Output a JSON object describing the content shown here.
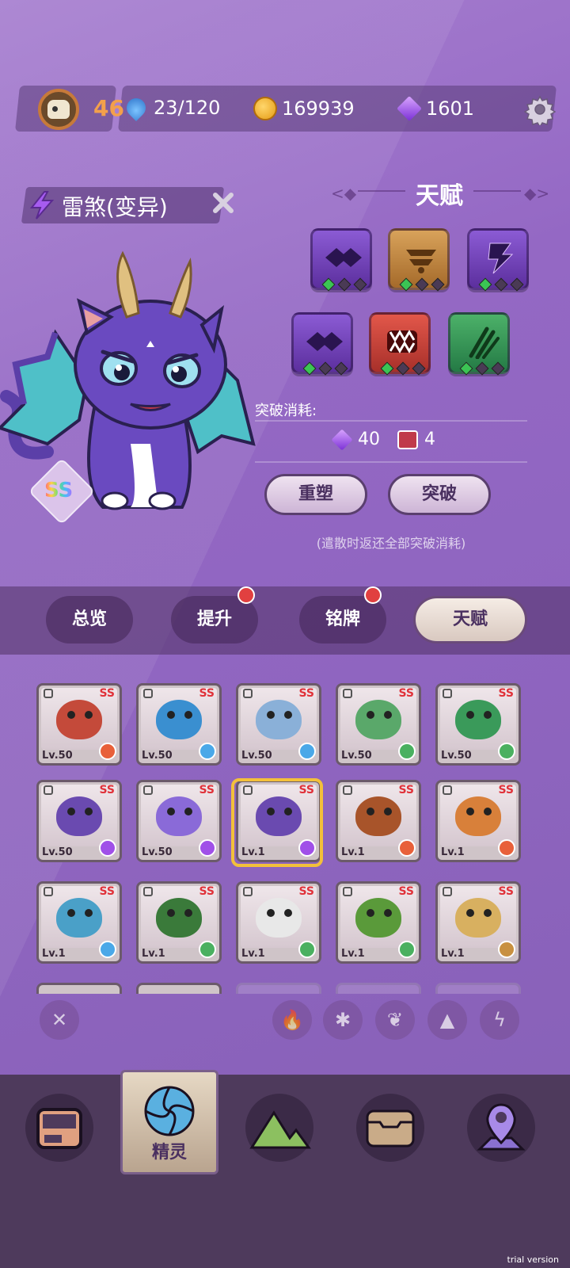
{
  "topbar": {
    "level": "46",
    "stamina": "23/120",
    "coins": "169939",
    "gems": "1601",
    "icons": [
      "skull-avatar",
      "water-drop-icon",
      "paw-coin-icon",
      "purple-gem-icon",
      "gear-icon"
    ]
  },
  "creature": {
    "name": "雷煞(变异)",
    "grade": "SS",
    "element": "lightning"
  },
  "talent": {
    "title": "天赋",
    "skills": [
      {
        "icon": "purple-diamond-skill",
        "color": "#7a48c4",
        "stars": 1
      },
      {
        "icon": "gold-crown-skill",
        "color": "#c08a40",
        "stars": 1
      },
      {
        "icon": "lightning-skill",
        "color": "#7a48c4",
        "stars": 1
      },
      {
        "icon": "purple-diamond-skill",
        "color": "#7a48c4",
        "stars": 1
      },
      {
        "icon": "fang-skill",
        "color": "#c8443a",
        "stars": 1
      },
      {
        "icon": "claw-skill",
        "color": "#3a9a58",
        "stars": 1
      }
    ],
    "cost_label": "突破消耗:",
    "cost_gem": "40",
    "cost_book": "4",
    "reshape_button": "重塑",
    "breakthrough_button": "突破",
    "hint": "(遣散时返还全部突破消耗)"
  },
  "tabs": [
    {
      "label": "总览",
      "badge": false
    },
    {
      "label": "提升",
      "badge": true
    },
    {
      "label": "铭牌",
      "badge": true
    },
    {
      "label": "天赋",
      "badge": false,
      "active": true
    }
  ],
  "cards": [
    {
      "lv": "Lv.50",
      "grade": "SS",
      "color": "#c44a3a",
      "element": "fire"
    },
    {
      "lv": "Lv.50",
      "grade": "SS",
      "color": "#3a8fd0",
      "element": "ice"
    },
    {
      "lv": "Lv.50",
      "grade": "SS",
      "color": "#8ab0d8",
      "element": "ice"
    },
    {
      "lv": "Lv.50",
      "grade": "SS",
      "color": "#5aa86a",
      "element": "leaf"
    },
    {
      "lv": "Lv.50",
      "grade": "SS",
      "color": "#3a9a5a",
      "element": "leaf"
    },
    {
      "lv": "Lv.50",
      "grade": "SS",
      "color": "#6a4ab0",
      "element": "lightning"
    },
    {
      "lv": "Lv.50",
      "grade": "SS",
      "color": "#8a6ad8",
      "element": "lightning"
    },
    {
      "lv": "Lv.1",
      "grade": "SS",
      "color": "#6a4ab0",
      "element": "lightning"
    },
    {
      "lv": "Lv.1",
      "grade": "SS",
      "color": "#a8542a",
      "element": "fire"
    },
    {
      "lv": "Lv.1",
      "grade": "SS",
      "color": "#d8803a",
      "element": "fire"
    },
    {
      "lv": "Lv.1",
      "grade": "SS",
      "color": "#4aa0c8",
      "element": "ice"
    },
    {
      "lv": "Lv.1",
      "grade": "SS",
      "color": "#3a7a3a",
      "element": "leaf"
    },
    {
      "lv": "Lv.1",
      "grade": "SS",
      "color": "#e8e8e8",
      "element": "leaf"
    },
    {
      "lv": "Lv.1",
      "grade": "SS",
      "color": "#5a9a3a",
      "element": "leaf"
    },
    {
      "lv": "Lv.1",
      "grade": "SS",
      "color": "#d8b060",
      "element": "earth"
    }
  ],
  "filters": [
    "close",
    "fire",
    "ice",
    "leaf",
    "earth",
    "lightning"
  ],
  "bottom_nav": {
    "items": [
      "bag-icon",
      "spirit-icon",
      "mountain-icon",
      "chest-icon",
      "map-pin-icon"
    ],
    "active_label": "精灵"
  },
  "watermark": "trial version"
}
